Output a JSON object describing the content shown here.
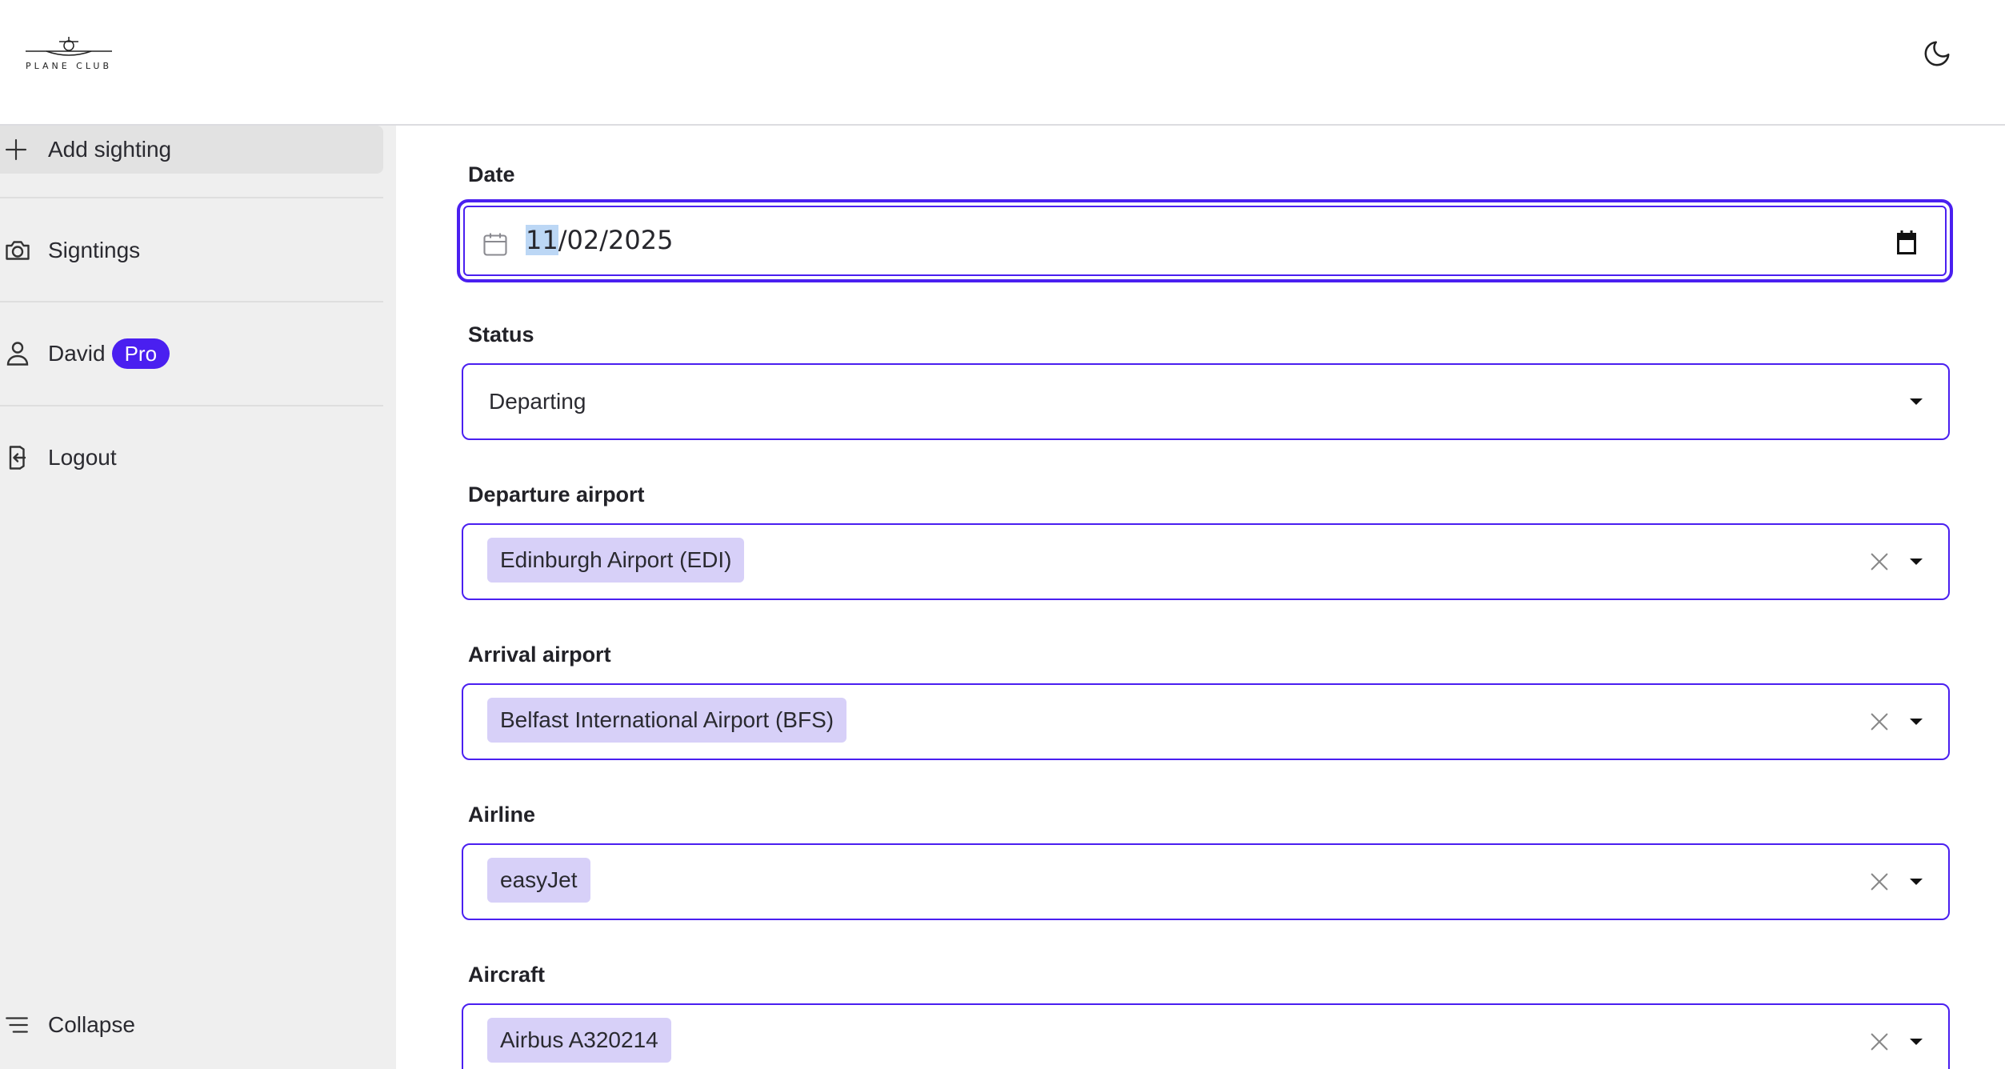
{
  "header": {
    "logo_text": "PLANE CLUB",
    "theme_toggle_icon": "moon-icon"
  },
  "sidebar": {
    "items": [
      {
        "label": "Add sighting",
        "icon": "plus-icon"
      },
      {
        "label": "Signtings",
        "icon": "camera-icon"
      },
      {
        "label": "David",
        "icon": "user-icon",
        "badge": "Pro"
      },
      {
        "label": "Logout",
        "icon": "logout-icon"
      }
    ],
    "collapse_label": "Collapse"
  },
  "form": {
    "date": {
      "label": "Date",
      "value_selected": "11",
      "value_rest": "/02/2025"
    },
    "status": {
      "label": "Status",
      "value": "Departing"
    },
    "departure_airport": {
      "label": "Departure airport",
      "value": "Edinburgh Airport (EDI)"
    },
    "arrival_airport": {
      "label": "Arrival airport",
      "value": "Belfast International Airport (BFS)"
    },
    "airline": {
      "label": "Airline",
      "value": "easyJet"
    },
    "aircraft": {
      "label": "Aircraft",
      "value": "Airbus A320214"
    }
  },
  "colors": {
    "accent": "#4a1ff0",
    "chip_bg": "#d7d0f8",
    "sidebar_bg": "#efefef"
  }
}
